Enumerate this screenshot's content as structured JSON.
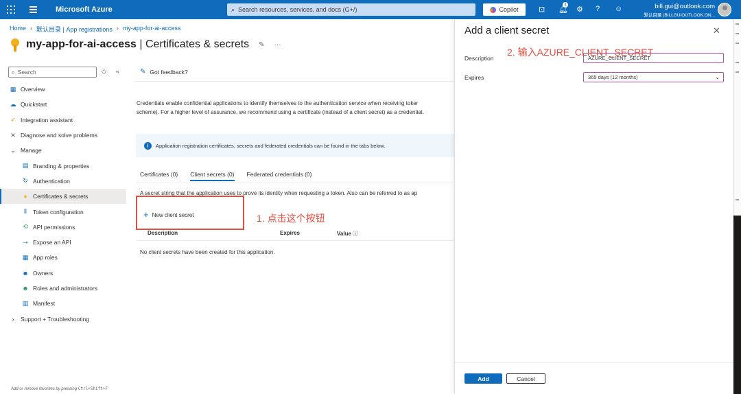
{
  "topbar": {
    "brand": "Microsoft Azure",
    "search_placeholder": "Search resources, services, and docs (G+/)",
    "copilot_label": "Copilot",
    "notification_count": "1",
    "user_email": "bill.gui@outlook.com",
    "user_tenant": "默认目录 (BILLGUIOUTLOOK.ON..."
  },
  "breadcrumb": [
    "Home",
    "默认目录 | App registrations",
    "my-app-for-ai-access"
  ],
  "page": {
    "title_app": "my-app-for-ai-access",
    "title_rest": " | Certificates & secrets"
  },
  "sidebar": {
    "search_placeholder": "Search",
    "items": [
      {
        "label": "Overview",
        "level": 1,
        "icon": "overview-icon",
        "color": "#0f6cbd"
      },
      {
        "label": "Quickstart",
        "level": 1,
        "icon": "quickstart-icon",
        "color": "#0f6cbd"
      },
      {
        "label": "Integration assistant",
        "level": 1,
        "icon": "rocket-icon",
        "color": "#e8a317"
      },
      {
        "label": "Diagnose and solve problems",
        "level": 1,
        "icon": "wrench-icon",
        "color": "#605e5c"
      },
      {
        "label": "Manage",
        "level": 1,
        "icon": "chevron-down-icon",
        "color": "#323130"
      },
      {
        "label": "Branding & properties",
        "level": 2,
        "icon": "branding-icon",
        "color": "#0f6cbd"
      },
      {
        "label": "Authentication",
        "level": 2,
        "icon": "authentication-icon",
        "color": "#0f6cbd"
      },
      {
        "label": "Certificates & secrets",
        "level": 2,
        "icon": "key-icon",
        "color": "#f2b01e",
        "active": true
      },
      {
        "label": "Token configuration",
        "level": 2,
        "icon": "token-icon",
        "color": "#0f6cbd"
      },
      {
        "label": "API permissions",
        "level": 2,
        "icon": "api-permissions-icon",
        "color": "#2e9e5c"
      },
      {
        "label": "Expose an API",
        "level": 2,
        "icon": "cloud-icon",
        "color": "#0f6cbd"
      },
      {
        "label": "App roles",
        "level": 2,
        "icon": "app-roles-icon",
        "color": "#0f6cbd"
      },
      {
        "label": "Owners",
        "level": 2,
        "icon": "owners-icon",
        "color": "#0f6cbd"
      },
      {
        "label": "Roles and administrators",
        "level": 2,
        "icon": "roles-icon",
        "color": "#2e9e5c"
      },
      {
        "label": "Manifest",
        "level": 2,
        "icon": "manifest-icon",
        "color": "#0f6cbd"
      },
      {
        "label": "Support + Troubleshooting",
        "level": 1,
        "icon": "chevron-right-icon",
        "color": "#323130"
      }
    ],
    "footer_text": "Add or remove favorites by pressing ",
    "footer_keys": "Ctrl+Shift+F"
  },
  "main": {
    "feedback_label": "Got feedback?",
    "description": "Credentials enable confidential applications to identify themselves to the authentication service when receiving toker\nscheme). For a higher level of assurance, we recommend using a certificate (instead of a client secret) as a credential.",
    "info_text": "Application registration certificates, secrets and federated credentials can be found in the tabs below.",
    "tabs": [
      "Certificates (0)",
      "Client secrets (0)",
      "Federated credentials (0)"
    ],
    "active_tab": 1,
    "secret_description": "A secret string that the application uses to prove its identity when requesting a token. Also can be referred to as ap",
    "new_secret_label": "New client secret",
    "columns": [
      "Description",
      "Expires",
      "Value"
    ],
    "empty_message": "No client secrets have been created for this application."
  },
  "annotations": {
    "step1": "1. 点击这个按钮",
    "step2": "2. 输入AZURE_CLIENT_SECRET"
  },
  "panel": {
    "title": "Add a client secret",
    "description_label": "Description",
    "description_value": "AZURE_CLIENT_SECRET",
    "expires_label": "Expires",
    "expires_value": "365 days (12 months)",
    "add_label": "Add",
    "cancel_label": "Cancel"
  },
  "colors": {
    "accent": "#0f6cbd",
    "annotation": "#e74c3c"
  }
}
